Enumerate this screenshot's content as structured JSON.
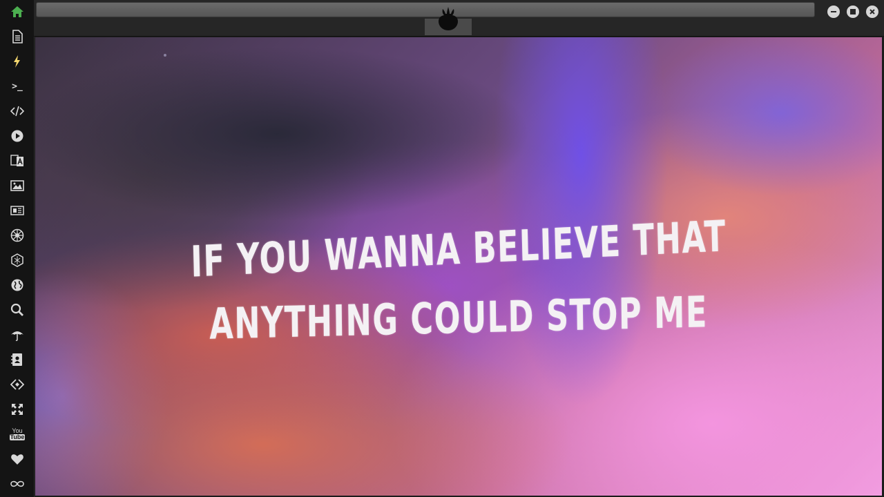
{
  "sidebar": {
    "items": [
      {
        "name": "home-icon",
        "icon": "home",
        "color": "#4caf50"
      },
      {
        "name": "document-icon",
        "icon": "document",
        "color": "#d8d8d8"
      },
      {
        "name": "lightning-icon",
        "icon": "lightning",
        "color": "#f5d76e"
      },
      {
        "name": "terminal-icon",
        "icon": "terminal",
        "color": "#d8d8d8"
      },
      {
        "name": "code-icon",
        "icon": "code",
        "color": "#d8d8d8"
      },
      {
        "name": "play-icon",
        "icon": "play",
        "color": "#d8d8d8"
      },
      {
        "name": "translate-icon",
        "icon": "translate",
        "color": "#d8d8d8"
      },
      {
        "name": "image-icon",
        "icon": "image",
        "color": "#d8d8d8"
      },
      {
        "name": "newspaper-icon",
        "icon": "newspaper",
        "color": "#d8d8d8"
      },
      {
        "name": "galactic-empire-icon",
        "icon": "empire",
        "color": "#d8d8d8"
      },
      {
        "name": "hexagon-icon",
        "icon": "hexagon",
        "color": "#d8d8d8"
      },
      {
        "name": "globe-icon",
        "icon": "globe",
        "color": "#d8d8d8"
      },
      {
        "name": "search-icon",
        "icon": "search",
        "color": "#d8d8d8"
      },
      {
        "name": "umbrella-icon",
        "icon": "umbrella",
        "color": "#d8d8d8"
      },
      {
        "name": "contacts-icon",
        "icon": "contacts",
        "color": "#d8d8d8"
      },
      {
        "name": "code-diamond-icon",
        "icon": "code-diamond",
        "color": "#d8d8d8"
      },
      {
        "name": "expand-icon",
        "icon": "expand",
        "color": "#d8d8d8"
      },
      {
        "name": "youtube-icon",
        "icon": "youtube",
        "color": "#d8d8d8"
      },
      {
        "name": "heart-icon",
        "icon": "heart",
        "color": "#d8d8d8"
      },
      {
        "name": "infinity-icon",
        "icon": "infinity",
        "color": "#d8d8d8"
      }
    ],
    "terminal_glyph": ">_",
    "youtube_label_top": "You",
    "youtube_label_bottom": "Tube"
  },
  "titlebar": {
    "logo": "rebel-alliance-logo-icon",
    "buttons": [
      "minimize",
      "maximize",
      "close"
    ]
  },
  "viewer": {
    "lyric_line_1": "IF YOU WANNA BELIEVE THAT",
    "lyric_line_2": "ANYTHING COULD STOP ME"
  }
}
